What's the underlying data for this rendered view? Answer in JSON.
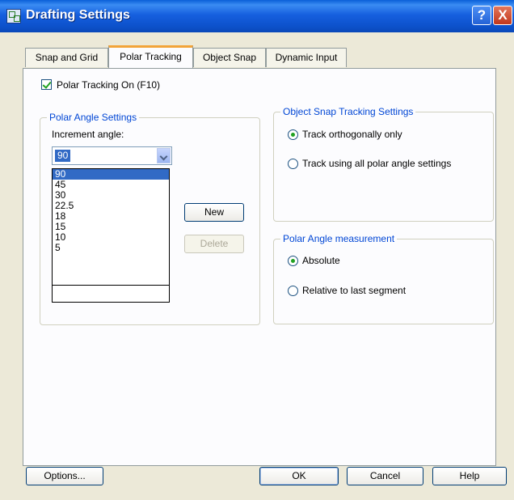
{
  "window": {
    "title": "Drafting Settings",
    "help_glyph": "?",
    "close_glyph": "X"
  },
  "tabs": [
    {
      "label": "Snap and Grid",
      "active": false
    },
    {
      "label": "Polar Tracking",
      "active": true
    },
    {
      "label": "Object Snap",
      "active": false
    },
    {
      "label": "Dynamic Input",
      "active": false
    }
  ],
  "polar_on": {
    "label": "Polar Tracking On (F10)",
    "checked": true
  },
  "polar_angle_settings": {
    "group_label": "Polar Angle Settings",
    "increment_label": "Increment angle:",
    "increment_value": "90",
    "options": [
      "90",
      "45",
      "30",
      "22.5",
      "18",
      "15",
      "10",
      "5"
    ],
    "selected_index": 0,
    "new_button": "New",
    "delete_button": "Delete"
  },
  "object_snap_tracking": {
    "group_label": "Object Snap Tracking Settings",
    "options": [
      {
        "label": "Track orthogonally only",
        "selected": true
      },
      {
        "label": "Track using all polar angle settings",
        "selected": false
      }
    ]
  },
  "polar_angle_measurement": {
    "group_label": "Polar Angle measurement",
    "options": [
      {
        "label": "Absolute",
        "selected": true
      },
      {
        "label": "Relative to last segment",
        "selected": false
      }
    ]
  },
  "footer": {
    "options_button": "Options...",
    "ok_button": "OK",
    "cancel_button": "Cancel",
    "help_button": "Help"
  },
  "colors": {
    "titlebar": "#0a5fd8",
    "group_title": "#0046d5",
    "selection": "#316ac5",
    "check": "#21a121",
    "active_tab_accent": "#f2a43a",
    "face": "#ece9d8"
  }
}
